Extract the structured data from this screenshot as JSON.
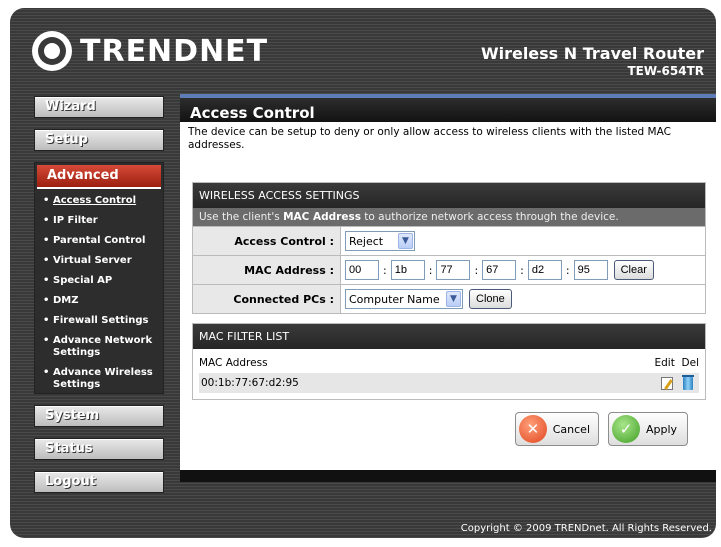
{
  "brand": {
    "logo_text": "TRENDNET",
    "product_name": "Wireless N Travel Router",
    "model": "TEW-654TR"
  },
  "nav": {
    "wizard": "Wizard",
    "setup": "Setup",
    "advanced": "Advanced",
    "advanced_items": [
      "Access Control",
      "IP Filter",
      "Parental Control",
      "Virtual Server",
      "Special AP",
      "DMZ",
      "Firewall Settings",
      "Advance Network Settings",
      "Advance Wireless Settings"
    ],
    "system": "System",
    "status": "Status",
    "logout": "Logout"
  },
  "page": {
    "title": "Access Control",
    "intro": "The device can be setup to deny or only allow access to wireless clients with the listed MAC addresses."
  },
  "wireless": {
    "heading": "WIRELESS ACCESS SETTINGS",
    "note_prefix": "Use the client's ",
    "note_bold": "MAC Address",
    "note_suffix": " to authorize network access through the device.",
    "access_label": "Access Control :",
    "access_value": "Reject",
    "mac_label": "MAC Address :",
    "mac_octets": [
      "00",
      "1b",
      "77",
      "67",
      "d2",
      "95"
    ],
    "clear_label": "Clear",
    "pcs_label": "Connected PCs :",
    "pcs_value": "Computer Name",
    "clone_label": "Clone"
  },
  "filter": {
    "heading": "MAC FILTER LIST",
    "col_mac": "MAC Address",
    "col_edit": "Edit",
    "col_del": "Del",
    "entries": [
      "00:1b:77:67:d2:95"
    ]
  },
  "actions": {
    "cancel": "Cancel",
    "apply": "Apply"
  },
  "footer": "Copyright © 2009 TRENDnet. All Rights Reserved."
}
